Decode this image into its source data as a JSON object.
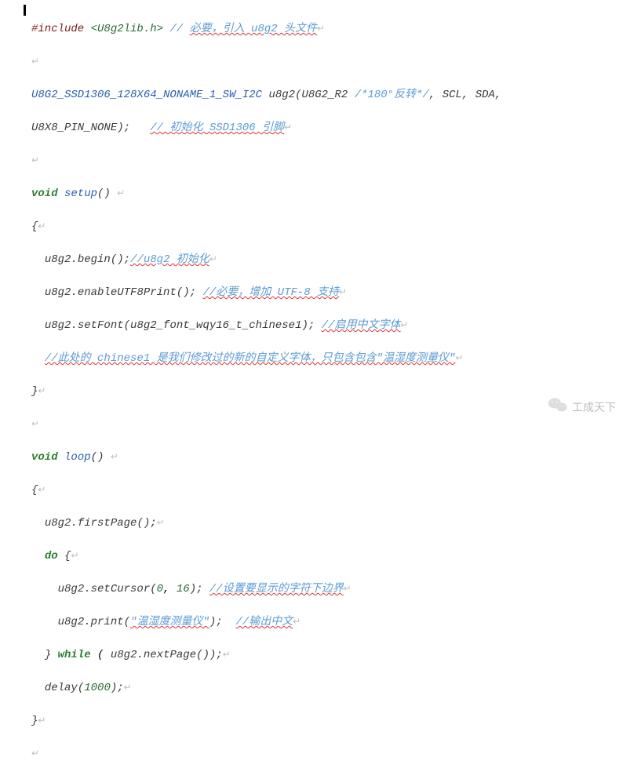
{
  "eol": "↵",
  "code": {
    "l1": {
      "pre": "#include",
      "sp": " ",
      "path": "<U8g2lib.h>",
      "rest": " // ",
      "cmt": "必要，引入 u8g2 头文件"
    },
    "l2": "",
    "l3": {
      "type": "U8G2_SSD1306_128X64_NONAME_1_SW_I2C",
      "decl": " u8g2(U8G2_R2 ",
      "cmt1": "/*180°反转*/",
      "decl2": ", SCL, SDA,"
    },
    "l4": {
      "decl": "U8X8_PIN_NONE);",
      "pad": "   ",
      "cmt": "// 初始化 SSD1306 引脚"
    },
    "l5": "",
    "l6": {
      "kw": "void",
      "sp": " ",
      "name": "setup",
      "paren": "() "
    },
    "l7": {
      "brace": "{"
    },
    "l8": {
      "ind": "  ",
      "obj": "u8g2",
      "dot": ".",
      "fn": "begin",
      "args": "();",
      "cmt": "//u8g2 初始化"
    },
    "l9": {
      "ind": "  ",
      "obj": "u8g2",
      "dot": ".",
      "fn": "enableUTF8Print",
      "args": "(); ",
      "cmt": "//必要，增加 UTF-8 支持"
    },
    "l10": {
      "ind": "  ",
      "obj": "u8g2",
      "dot": ".",
      "fn": "setFont",
      "args_open": "(",
      "arg_ident": "u8g2_font_wqy16_t_chinese1",
      "args_close": "); ",
      "cmt": "//启用中文字体"
    },
    "l11": {
      "ind": "  ",
      "cmt": "//此处的 chinese1 是我们修改过的新的自定义字体，只包含包含\"温湿度测量仪\""
    },
    "l12": {
      "brace": "}"
    },
    "l13": "",
    "l14": {
      "kw": "void",
      "sp": " ",
      "name": "loop",
      "paren": "() "
    },
    "l15": {
      "brace": "{"
    },
    "l16": {
      "ind": "  ",
      "obj": "u8g2",
      "dot": ".",
      "fn": "firstPage",
      "args": "();"
    },
    "l17": {
      "ind": "  ",
      "kw": "do",
      "rest": " {"
    },
    "l18": {
      "ind": "    ",
      "obj": "u8g2",
      "dot": ".",
      "fn": "setCursor",
      "args_open": "(",
      "num1": "0",
      "comma": ", ",
      "num2": "16",
      "args_close": "); ",
      "cmt": "//设置要显示的字符下边界"
    },
    "l19": {
      "ind": "    ",
      "obj": "u8g2",
      "dot": ".",
      "fn": "print",
      "args_open": "(",
      "str": "\"温湿度测量仪\"",
      "args_close": ");  ",
      "cmt": "//输出中文"
    },
    "l20": {
      "ind": "  ",
      "close": "} ",
      "kw": "while",
      "rest": " ( ",
      "obj": "u8g2",
      "dot": ".",
      "fn": "nextPage",
      "args": "());"
    },
    "l21": {
      "ind": "  ",
      "fn": "delay",
      "args_open": "(",
      "num": "1000",
      "args_close": ");"
    },
    "l22": {
      "brace": "}"
    }
  },
  "watermark": {
    "text": "工成天下"
  }
}
